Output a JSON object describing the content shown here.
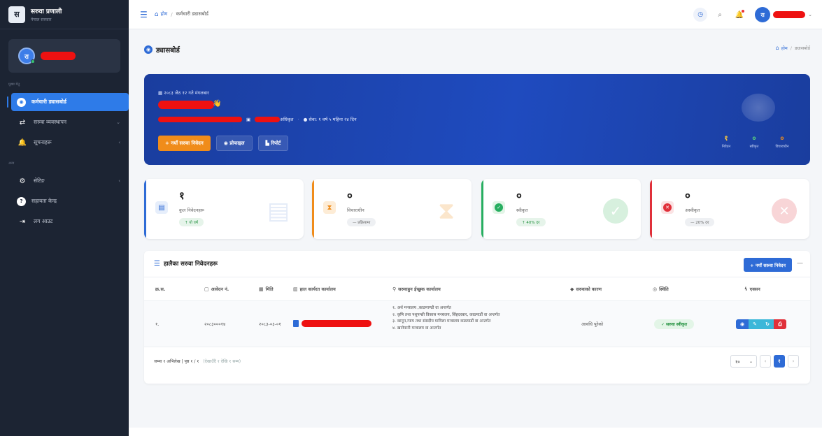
{
  "brand": {
    "logo_glyph": "स",
    "title": "सरुवा प्रणाली",
    "subtitle": "नेपाल सरकार"
  },
  "user": {
    "initial": "रा"
  },
  "sidebar": {
    "section_main": "मुख्य मेनु",
    "section_other": "अन्य",
    "items": [
      {
        "label": "कर्मचारी ड्यासबोर्ड",
        "icon": "dashboard-icon"
      },
      {
        "label": "सरुवा व्यवस्थापन",
        "icon": "transfer-icon"
      },
      {
        "label": "सूचनाहरू",
        "icon": "bell-icon"
      },
      {
        "label": "सेटिङ",
        "icon": "gear-icon"
      },
      {
        "label": "सहायता केन्द्र",
        "icon": "help-icon"
      },
      {
        "label": "लग आउट",
        "icon": "logout-icon"
      }
    ]
  },
  "topbar": {
    "home": "होम",
    "current": "कर्मचारी ड्यासबोर्ड",
    "avatar_initial": "रा"
  },
  "page": {
    "title": "ड्यासबोर्ड",
    "crumb_home": "होम",
    "crumb_current": "ड्यासबोर्ड"
  },
  "hero": {
    "date": "२०८३ जेठ १२ गते मंगलबार",
    "wave": "👋",
    "position": "अधिकृत",
    "service": "सेवा: १ वर्ष ५ महिना २४ दिन",
    "btn_new": "+ नयाँ सरुवा निवेदन",
    "btn_profile": "प्रोफाइल",
    "btn_report": "रिपोर्ट",
    "stats": [
      {
        "value": "१",
        "label": "निवेदन",
        "color": "#f5c542"
      },
      {
        "value": "०",
        "label": "स्वीकृत",
        "color": "#5ad67d"
      },
      {
        "value": "०",
        "label": "विचाराधीन",
        "color": "#f08c1a"
      }
    ]
  },
  "cards": [
    {
      "value": "१",
      "label": "कुल निवेदनहरू",
      "pill": "↑ यो वर्ष",
      "accent": "#2e6bd6",
      "icon": "file-icon"
    },
    {
      "value": "०",
      "label": "विचाराधीन",
      "pill": "— प्रक्रियामा",
      "accent": "#f08c1a",
      "icon": "hourglass-icon"
    },
    {
      "value": "०",
      "label": "स्वीकृत",
      "pill": "↑ 40% दर",
      "accent": "#27ae60",
      "icon": "check-icon"
    },
    {
      "value": "०",
      "label": "अस्वीकृत",
      "pill": "— 20% दर",
      "accent": "#e0303a",
      "icon": "x-icon"
    }
  ],
  "recent": {
    "title": "हालैका सरुवा निवेदनहरू",
    "btn_new": "+ नयाँ सरुवा निवेदन",
    "minimize": "—",
    "columns": {
      "sn": "क्र.स.",
      "app_no": "आवेदन नं.",
      "date": "मिति",
      "office": "हाल कार्यरत कार्यालय",
      "desired": "सरुवाहुन ईच्छुक कार्यालय",
      "reason": "सरुवाको कारण",
      "status": "स्थिति",
      "action": "एक्सन"
    },
    "rows": [
      {
        "sn": "१.",
        "app_no": "२०८३०००१४",
        "date": "२०८३-०३-०१",
        "desired": [
          "१. अर्थ मन्त्रालय ,काठमाण्डौ वा अन्तर्गत",
          "२. कृषि तथा पशुपन्छी विकास मन्त्रालय, सिंहदरबार, काठमाडौं वा अन्तर्गत",
          "३. कानून,न्याय तथा संसदीय मामिला मन्त्रालय काठमाडौं वा अन्तर्गत",
          "४. खानेपानी मन्त्रालय वा अन्तर्गत"
        ],
        "reason": "आवधि पुरेको",
        "status": "✓ सरुवा स्वीकृत"
      }
    ],
    "footer_text": "जम्मा १ अभिलेख | पृष्ठ १ / १",
    "footer_muted": "(देखाउँदै १ देखि १ सम्म)",
    "page_size": "१०",
    "current_page": "१"
  }
}
